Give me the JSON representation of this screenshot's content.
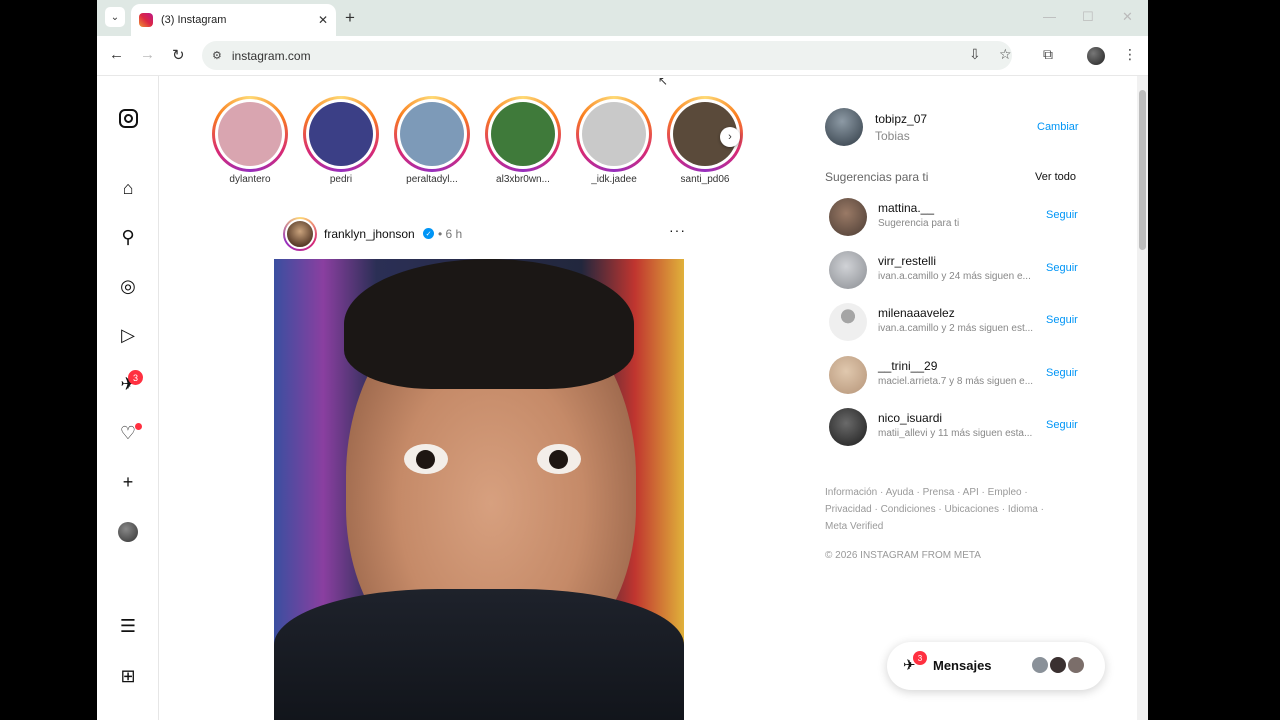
{
  "browser": {
    "tab_title": "(3) Instagram",
    "url": "instagram.com"
  },
  "stories": [
    {
      "name": "dylantero",
      "color": "#d9a5b0"
    },
    {
      "name": "pedri",
      "color": "#3b3f86"
    },
    {
      "name": "peraltadyl...",
      "color": "#7d9ab8"
    },
    {
      "name": "al3xbr0wn...",
      "color": "#3f7a3a"
    },
    {
      "name": "_idk.jadee",
      "color": "#c9c9c9"
    },
    {
      "name": "santi_pd06",
      "color": "#5a4a3a"
    }
  ],
  "post": {
    "username": "franklyn_jhonson",
    "time": "• 6 h",
    "more": "···"
  },
  "nav": {
    "messages_badge": "3"
  },
  "profile": {
    "username": "tobipz_07",
    "name": "Tobias",
    "switch_label": "Cambiar"
  },
  "suggestions": {
    "title": "Sugerencias para ti",
    "see_all": "Ver todo",
    "follow_label": "Seguir",
    "items": [
      {
        "username": "mattina.__",
        "subtitle": "Sugerencia para ti",
        "color": "#4a3b33"
      },
      {
        "username": "virr_restelli",
        "subtitle": "ivan.a.camillo y 24 más siguen e...",
        "color": "#8a8d92"
      },
      {
        "username": "milenaaavelez",
        "subtitle": "ivan.a.camillo y 2 más siguen est...",
        "color": "#c8c8c8"
      },
      {
        "username": "__trini__29",
        "subtitle": "maciel.arrieta.7 y 8 más siguen e...",
        "color": "#b59478"
      },
      {
        "username": "nico_isuardi",
        "subtitle": "matii_allevi y 11 más siguen esta...",
        "color": "#2b2b2b"
      }
    ]
  },
  "footer": {
    "links": "Información · Ayuda · Prensa · API · Empleo · Privacidad · Condiciones · Ubicaciones · Idioma · Meta Verified",
    "copyright": "© 2026 INSTAGRAM FROM META"
  },
  "messages_pill": {
    "label": "Mensajes",
    "badge": "3"
  }
}
